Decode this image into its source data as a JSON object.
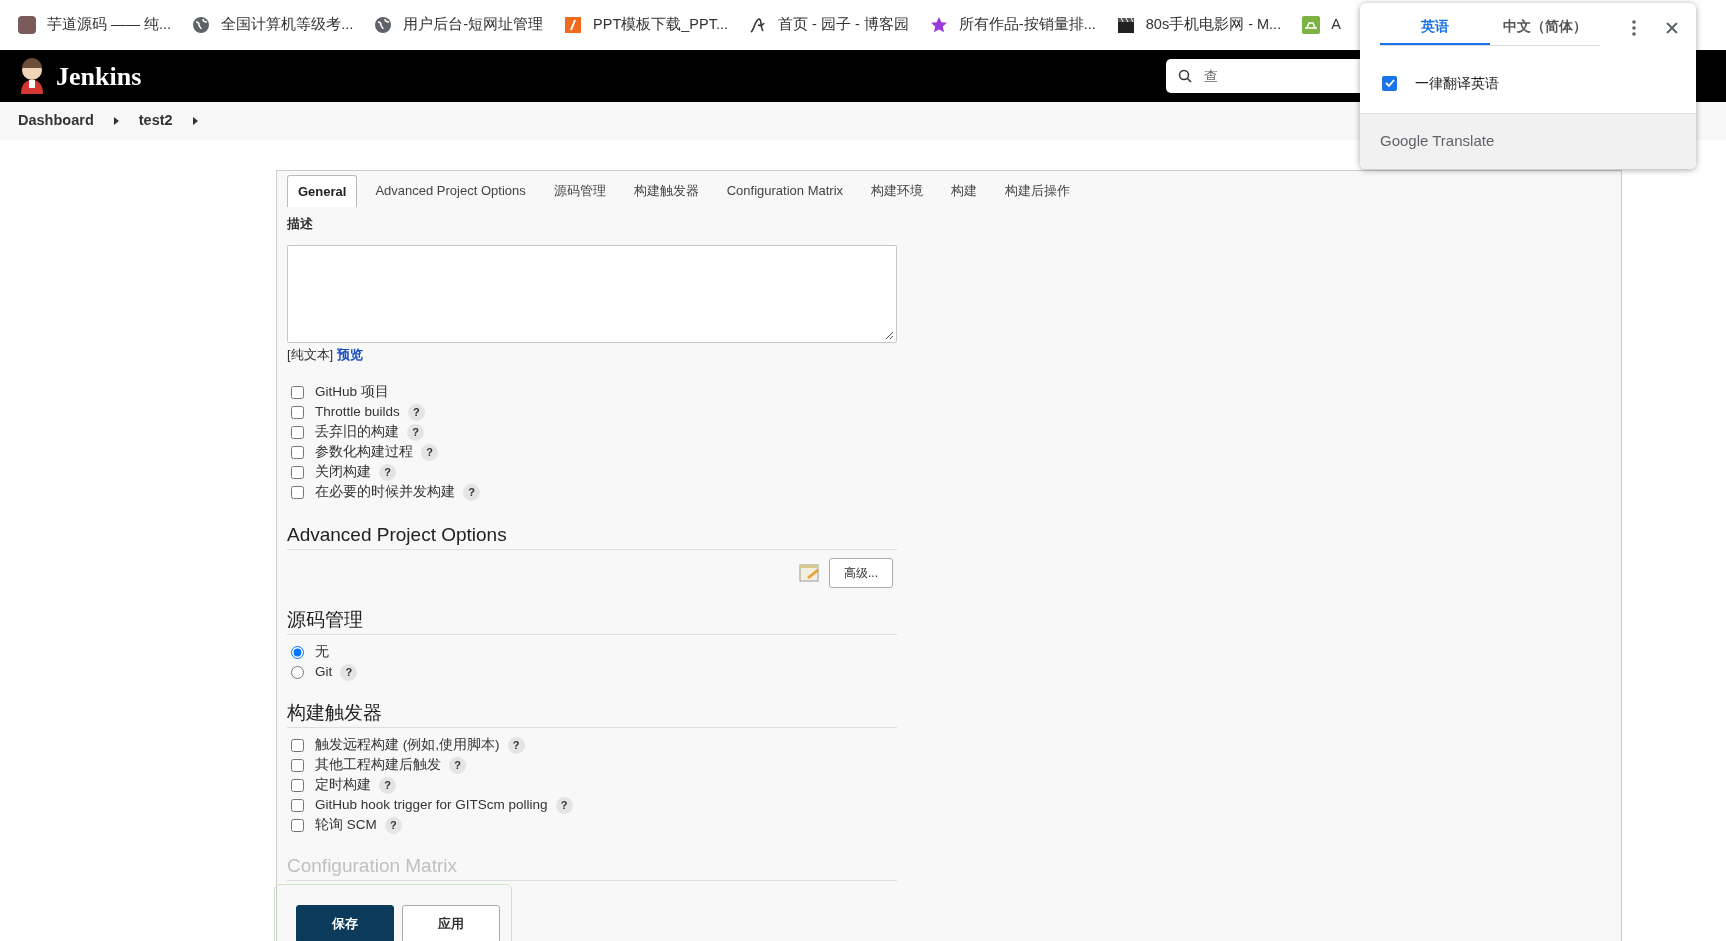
{
  "bookmarks": [
    {
      "kind": "avatar",
      "label": "芋道源码 —— 纯..."
    },
    {
      "kind": "globe",
      "label": "全国计算机等级考..."
    },
    {
      "kind": "globe",
      "label": "用户后台-短网址管理"
    },
    {
      "kind": "slide",
      "label": "PPT模板下载_PPT..."
    },
    {
      "kind": "script",
      "label": "首页 - 园子 - 博客园"
    },
    {
      "kind": "star",
      "label": "所有作品-按销量排..."
    },
    {
      "kind": "film",
      "label": "80s手机电影网 - M..."
    },
    {
      "kind": "chip",
      "label": "A"
    }
  ],
  "header": {
    "title": "Jenkins",
    "search": {
      "placeholder": "查"
    }
  },
  "breadcrumb": [
    "Dashboard",
    "test2"
  ],
  "tabs": [
    {
      "label": "General",
      "selected": true
    },
    {
      "label": "Advanced Project Options",
      "selected": false
    },
    {
      "label": "源码管理",
      "selected": false
    },
    {
      "label": "构建触发器",
      "selected": false
    },
    {
      "label": "Configuration Matrix",
      "selected": false
    },
    {
      "label": "构建环境",
      "selected": false
    },
    {
      "label": "构建",
      "selected": false
    },
    {
      "label": "构建后操作",
      "selected": false
    }
  ],
  "general": {
    "description_label": "描述",
    "format_note": "[纯文本]",
    "preview_link": "预览",
    "options": [
      {
        "label": "GitHub 项目",
        "checked": false
      },
      {
        "label": "Throttle builds",
        "checked": false,
        "help": "?"
      },
      {
        "label": "丢弃旧的构建",
        "checked": false,
        "help": "?"
      },
      {
        "label": "参数化构建过程",
        "checked": false,
        "help": "?"
      },
      {
        "label": "关闭构建",
        "checked": false,
        "help": "?"
      },
      {
        "label": "在必要的时候并发构建",
        "checked": false,
        "help": "?"
      }
    ]
  },
  "sections": [
    {
      "kind": "advanced",
      "title": "Advanced Project Options",
      "button": "高级..."
    },
    {
      "kind": "radio",
      "title": "源码管理",
      "options": [
        {
          "label": "无",
          "selected": true
        },
        {
          "label": "Git",
          "selected": false,
          "help": "?"
        }
      ]
    },
    {
      "kind": "checkbox",
      "title": "构建触发器",
      "options": [
        {
          "label": "触发远程构建 (例如,使用脚本)",
          "checked": false,
          "help": "?"
        },
        {
          "label": "其他工程构建后触发",
          "checked": false,
          "help": "?"
        },
        {
          "label": "定时构建",
          "checked": false,
          "help": "?"
        },
        {
          "label": "GitHub hook trigger for GITScm polling",
          "checked": false,
          "help": "?"
        },
        {
          "label": "轮询 SCM",
          "checked": false,
          "help": "?"
        }
      ]
    },
    {
      "kind": "heading",
      "title": "Configuration Matrix"
    }
  ],
  "bottom_bar": {
    "buttons": [
      {
        "label": "保存",
        "kind": "primary"
      },
      {
        "label": "应用",
        "kind": "secondary"
      }
    ]
  },
  "translate_popup": {
    "tabs": [
      {
        "label": "英语",
        "selected": true
      },
      {
        "label": "中文（简体）",
        "selected": false
      }
    ],
    "option": {
      "label": "一律翻译英语",
      "checked": true
    },
    "footer": "Google Translate"
  }
}
